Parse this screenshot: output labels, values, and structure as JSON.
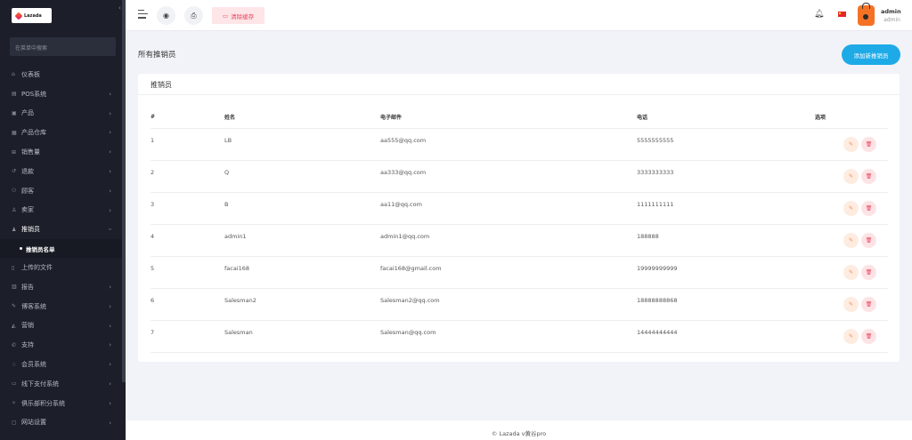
{
  "sidebar": {
    "logo_text": "Lazada",
    "search_placeholder": "在菜单中搜索",
    "items": [
      {
        "label": "仪表板",
        "icon": "home-icon",
        "has_children": false
      },
      {
        "label": "POS系统",
        "icon": "pos-icon",
        "has_children": true
      },
      {
        "label": "产品",
        "icon": "box-icon",
        "has_children": true
      },
      {
        "label": "产品仓库",
        "icon": "warehouse-icon",
        "has_children": true
      },
      {
        "label": "销售量",
        "icon": "cart-icon",
        "has_children": true
      },
      {
        "label": "退款",
        "icon": "refund-icon",
        "has_children": true
      },
      {
        "label": "顾客",
        "icon": "users-icon",
        "has_children": true
      },
      {
        "label": "卖家",
        "icon": "user-icon",
        "has_children": true
      },
      {
        "label": "推销员",
        "icon": "salesman-icon",
        "has_children": true
      },
      {
        "label": "上传的文件",
        "icon": "file-icon",
        "has_children": false
      },
      {
        "label": "报告",
        "icon": "report-icon",
        "has_children": true
      },
      {
        "label": "博客系统",
        "icon": "blog-icon",
        "has_children": true
      },
      {
        "label": "营销",
        "icon": "bullhorn-icon",
        "has_children": true
      },
      {
        "label": "支持",
        "icon": "support-icon",
        "has_children": true
      },
      {
        "label": "会员系统",
        "icon": "member-icon",
        "has_children": true
      },
      {
        "label": "线下支付系统",
        "icon": "payment-icon",
        "has_children": true
      },
      {
        "label": "俱乐部积分系统",
        "icon": "points-icon",
        "has_children": true
      },
      {
        "label": "网站设置",
        "icon": "monitor-icon",
        "has_children": true
      }
    ],
    "active_sub_item": "推销员名单"
  },
  "topbar": {
    "clear_cache_label": "清除缓存",
    "user_name": "admin",
    "user_role": "admin"
  },
  "page": {
    "title": "所有推销员",
    "add_button": "添加新推销员",
    "card_title": "推销员"
  },
  "table": {
    "headers": [
      "#",
      "姓名",
      "电子邮件",
      "电话",
      "选项"
    ],
    "rows": [
      {
        "no": "1",
        "name": "LB",
        "email": "aa555@qq.com",
        "phone": "5555555555"
      },
      {
        "no": "2",
        "name": "Q",
        "email": "aa333@qq.com",
        "phone": "3333333333"
      },
      {
        "no": "3",
        "name": "B",
        "email": "aa11@qq.com",
        "phone": "1111111111"
      },
      {
        "no": "4",
        "name": "admin1",
        "email": "admin1@qq.com",
        "phone": "188888"
      },
      {
        "no": "5",
        "name": "facai168",
        "email": "facai168@gmail.com",
        "phone": "19999999999"
      },
      {
        "no": "6",
        "name": "Salesman2",
        "email": "Salesman2@qq.com",
        "phone": "18888888868"
      },
      {
        "no": "7",
        "name": "Salesman",
        "email": "Salesman@qq.com",
        "phone": "14444444444"
      }
    ]
  },
  "footer": {
    "text": "© Lazada v黄谷pro"
  }
}
